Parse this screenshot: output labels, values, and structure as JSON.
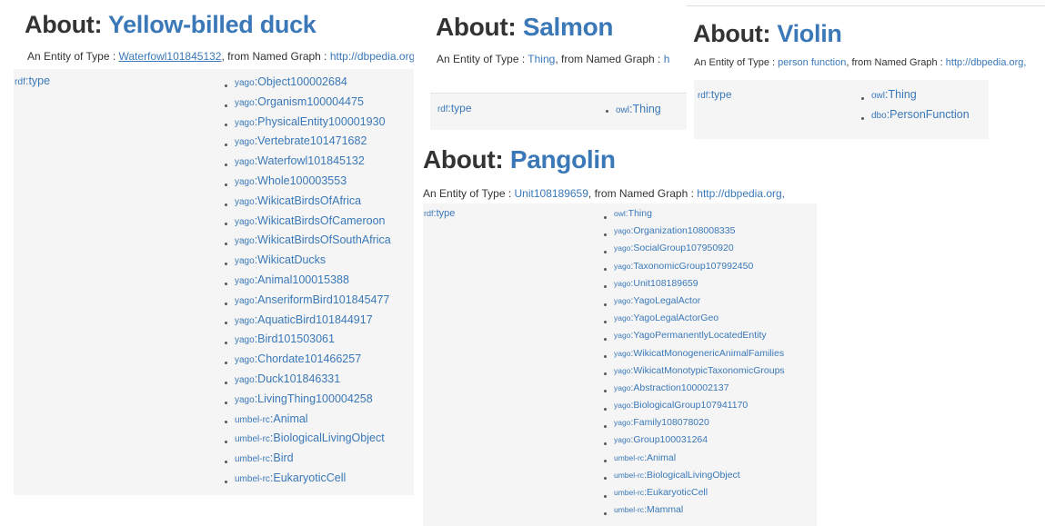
{
  "duck": {
    "title_prefix": "About: ",
    "title_name": "Yellow-billed duck",
    "subtitle_text": "An Entity of Type : ",
    "subtitle_type": "Waterfowl101845132",
    "subtitle_mid": ", from Named Graph : ",
    "subtitle_graph": "http://dbpedia.org,",
    "prop_prefix": "rdf",
    "prop_name": ":type",
    "values": [
      {
        "prefix": "yago",
        "name": ":Object100002684"
      },
      {
        "prefix": "yago",
        "name": ":Organism100004475"
      },
      {
        "prefix": "yago",
        "name": ":PhysicalEntity100001930"
      },
      {
        "prefix": "yago",
        "name": ":Vertebrate101471682"
      },
      {
        "prefix": "yago",
        "name": ":Waterfowl101845132"
      },
      {
        "prefix": "yago",
        "name": ":Whole100003553"
      },
      {
        "prefix": "yago",
        "name": ":WikicatBirdsOfAfrica"
      },
      {
        "prefix": "yago",
        "name": ":WikicatBirdsOfCameroon"
      },
      {
        "prefix": "yago",
        "name": ":WikicatBirdsOfSouthAfrica"
      },
      {
        "prefix": "yago",
        "name": ":WikicatDucks"
      },
      {
        "prefix": "yago",
        "name": ":Animal100015388"
      },
      {
        "prefix": "yago",
        "name": ":AnseriformBird101845477"
      },
      {
        "prefix": "yago",
        "name": ":AquaticBird101844917"
      },
      {
        "prefix": "yago",
        "name": ":Bird101503061"
      },
      {
        "prefix": "yago",
        "name": ":Chordate101466257"
      },
      {
        "prefix": "yago",
        "name": ":Duck101846331"
      },
      {
        "prefix": "yago",
        "name": ":LivingThing100004258"
      },
      {
        "prefix": "umbel-rc",
        "name": ":Animal"
      },
      {
        "prefix": "umbel-rc",
        "name": ":BiologicalLivingObject"
      },
      {
        "prefix": "umbel-rc",
        "name": ":Bird"
      },
      {
        "prefix": "umbel-rc",
        "name": ":EukaryoticCell"
      }
    ]
  },
  "salmon": {
    "title_prefix": "About: ",
    "title_name": "Salmon",
    "subtitle_text": "An Entity of Type : ",
    "subtitle_type": "Thing",
    "subtitle_mid": ", from Named Graph : ",
    "subtitle_graph": "h",
    "prop_prefix": "rdf",
    "prop_name": ":type",
    "values": [
      {
        "prefix": "owl",
        "name": ":Thing"
      }
    ]
  },
  "violin": {
    "title_prefix": "About: ",
    "title_name": "Violin",
    "subtitle_text": "An Entity of Type : ",
    "subtitle_type": "person function",
    "subtitle_mid": ", from Named Graph : ",
    "subtitle_graph": "http://dbpedia.org,",
    "prop_prefix": "rdf",
    "prop_name": ":type",
    "values": [
      {
        "prefix": "owl",
        "name": ":Thing"
      },
      {
        "prefix": "dbo",
        "name": ":PersonFunction"
      }
    ]
  },
  "pangolin": {
    "title_prefix": "About: ",
    "title_name": "Pangolin",
    "subtitle_text": "An Entity of Type : ",
    "subtitle_type": "Unit108189659",
    "subtitle_mid": ", from Named Graph : ",
    "subtitle_graph": "http://dbpedia.org,",
    "prop_prefix": "rdf",
    "prop_name": ":type",
    "values": [
      {
        "prefix": "owl",
        "name": ":Thing"
      },
      {
        "prefix": "yago",
        "name": ":Organization108008335"
      },
      {
        "prefix": "yago",
        "name": ":SocialGroup107950920"
      },
      {
        "prefix": "yago",
        "name": ":TaxonomicGroup107992450"
      },
      {
        "prefix": "yago",
        "name": ":Unit108189659"
      },
      {
        "prefix": "yago",
        "name": ":YagoLegalActor"
      },
      {
        "prefix": "yago",
        "name": ":YagoLegalActorGeo"
      },
      {
        "prefix": "yago",
        "name": ":YagoPermanentlyLocatedEntity"
      },
      {
        "prefix": "yago",
        "name": ":WikicatMonogenericAnimalFamilies"
      },
      {
        "prefix": "yago",
        "name": ":WikicatMonotypicTaxonomicGroups"
      },
      {
        "prefix": "yago",
        "name": ":Abstraction100002137"
      },
      {
        "prefix": "yago",
        "name": ":BiologicalGroup107941170"
      },
      {
        "prefix": "yago",
        "name": ":Family108078020"
      },
      {
        "prefix": "yago",
        "name": ":Group100031264"
      },
      {
        "prefix": "umbel-rc",
        "name": ":Animal"
      },
      {
        "prefix": "umbel-rc",
        "name": ":BiologicalLivingObject"
      },
      {
        "prefix": "umbel-rc",
        "name": ":EukaryoticCell"
      },
      {
        "prefix": "umbel-rc",
        "name": ":Mammal"
      }
    ]
  },
  "colors": {
    "link": "#3a78b8",
    "title_text": "#333333",
    "table_bg": "#f5f5f5"
  }
}
